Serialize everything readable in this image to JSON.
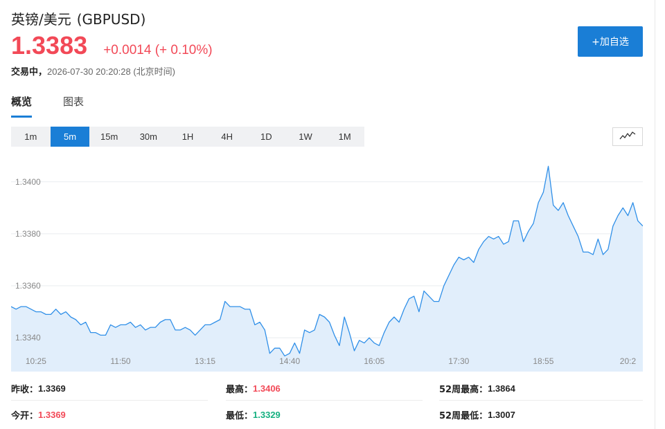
{
  "header": {
    "name": "英镑/美元",
    "code": "(GBPUSD)",
    "price": "1.3383",
    "change": "+0.0014 (+ 0.10%)",
    "status": "交易中，",
    "timestamp": "2026-07-30 20:20:28 (北京时间)",
    "add_button": "+加自选"
  },
  "tabs": [
    {
      "label": "概览",
      "active": true
    },
    {
      "label": "图表",
      "active": false
    }
  ],
  "timeframes": {
    "items": [
      "1m",
      "5m",
      "15m",
      "30m",
      "1H",
      "4H",
      "1D",
      "1W",
      "1M"
    ],
    "selected": "5m"
  },
  "chart_toggle_icon": "line-chart-icon",
  "chart_data": {
    "type": "area",
    "x_tick_labels": [
      "10:25",
      "11:50",
      "13:15",
      "14:40",
      "16:05",
      "17:30",
      "18:55",
      "20:2"
    ],
    "y_tick_labels": [
      "1.3400",
      "1.3380",
      "1.3360",
      "1.3340"
    ],
    "ylim": [
      1.3327,
      1.3409
    ],
    "y_ticks": [
      1.34,
      1.338,
      1.336,
      1.334
    ],
    "x_tick_index": [
      5,
      22,
      39,
      56,
      73,
      90,
      107,
      124
    ],
    "values": [
      1.3352,
      1.3351,
      1.3352,
      1.3352,
      1.3351,
      1.335,
      1.335,
      1.3349,
      1.3349,
      1.3351,
      1.3349,
      1.335,
      1.3348,
      1.3347,
      1.3345,
      1.3346,
      1.3342,
      1.3342,
      1.3341,
      1.3341,
      1.3345,
      1.3344,
      1.3345,
      1.3345,
      1.3346,
      1.3344,
      1.3345,
      1.3343,
      1.3344,
      1.3344,
      1.3346,
      1.3347,
      1.3347,
      1.3343,
      1.3343,
      1.3344,
      1.3343,
      1.3341,
      1.3343,
      1.3345,
      1.3345,
      1.3346,
      1.3347,
      1.3354,
      1.3352,
      1.3352,
      1.3352,
      1.3351,
      1.3351,
      1.3345,
      1.3346,
      1.3343,
      1.3334,
      1.3336,
      1.3336,
      1.3333,
      1.3334,
      1.3338,
      1.3334,
      1.3343,
      1.3342,
      1.3343,
      1.3349,
      1.3348,
      1.3346,
      1.3341,
      1.3337,
      1.3348,
      1.3342,
      1.3335,
      1.3339,
      1.3338,
      1.334,
      1.3338,
      1.3337,
      1.3342,
      1.3346,
      1.3348,
      1.3346,
      1.3351,
      1.3355,
      1.3356,
      1.335,
      1.3358,
      1.3356,
      1.3354,
      1.3354,
      1.336,
      1.3364,
      1.3368,
      1.3371,
      1.337,
      1.3371,
      1.3369,
      1.3374,
      1.3377,
      1.3379,
      1.3378,
      1.3379,
      1.3376,
      1.3377,
      1.3385,
      1.3385,
      1.3377,
      1.3381,
      1.3384,
      1.3392,
      1.3396,
      1.3406,
      1.3391,
      1.3389,
      1.3392,
      1.3387,
      1.3383,
      1.3379,
      1.3373,
      1.3373,
      1.3372,
      1.3378,
      1.3372,
      1.3374,
      1.3383,
      1.3387,
      1.339,
      1.3387,
      1.3392,
      1.3385,
      1.3383
    ],
    "line_color": "#2f8fe8",
    "fill_color": "#e1eefb",
    "grid": true
  },
  "stats": [
    {
      "label": "昨收：",
      "value": "1.3369",
      "color": "black"
    },
    {
      "label": "最高：",
      "value": "1.3406",
      "color": "red"
    },
    {
      "label": "52周最高：",
      "value": "1.3864",
      "color": "black"
    },
    {
      "label": "今开：",
      "value": "1.3369",
      "color": "red"
    },
    {
      "label": "最低：",
      "value": "1.3329",
      "color": "green"
    },
    {
      "label": "52周最低：",
      "value": "1.3007",
      "color": "black"
    }
  ]
}
